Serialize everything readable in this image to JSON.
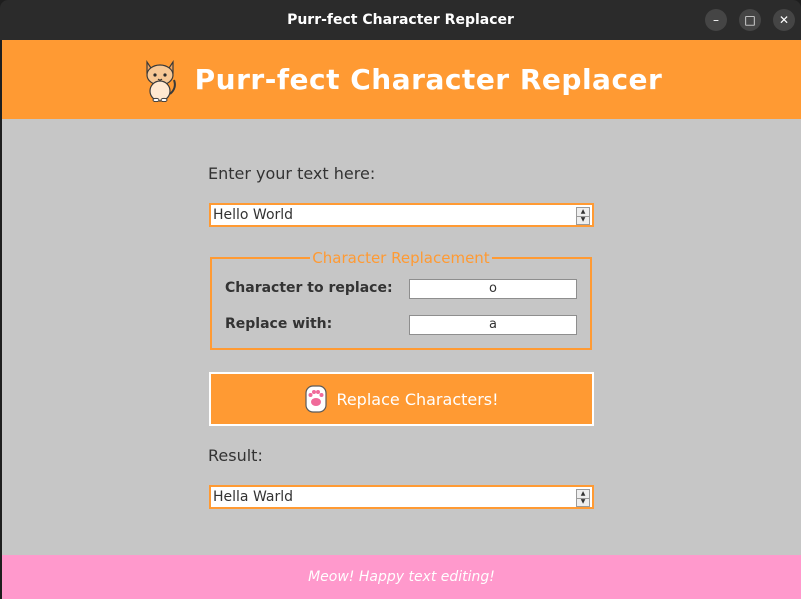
{
  "window": {
    "title": "Purr-fect Character Replacer",
    "controls": {
      "minimize": "–",
      "maximize": "□",
      "close": "✕"
    }
  },
  "header": {
    "title": "Purr-fect Character Replacer",
    "icon": "cat-icon"
  },
  "input": {
    "label": "Enter your text here:",
    "value": "Hello World"
  },
  "replacement": {
    "legend": "Character Replacement",
    "replace_label": "Character to replace:",
    "replace_value": "o",
    "with_label": "Replace with:",
    "with_value": "a"
  },
  "action": {
    "button_label": "Replace Characters!",
    "icon": "paw-icon"
  },
  "result": {
    "label": "Result:",
    "value": "Hella Warld"
  },
  "footer": {
    "text": "Meow! Happy text editing!"
  },
  "colors": {
    "accent": "#ff9a33",
    "background": "#c6c6c6",
    "footer": "#ff99cc",
    "titlebar": "#2b2b2b"
  }
}
